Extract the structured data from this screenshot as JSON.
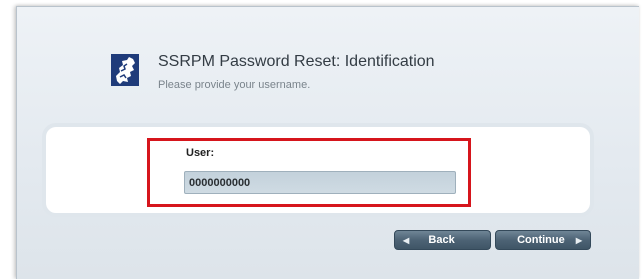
{
  "header": {
    "title": "SSRPM Password Reset: Identification",
    "subtitle": "Please provide your username.",
    "logo_icon": "ssrpm-logo-icon"
  },
  "form": {
    "user_label": "User:",
    "user_value": "0000000000"
  },
  "actions": {
    "back_label": "Back",
    "continue_label": "Continue"
  },
  "colors": {
    "highlight": "#d6151c",
    "button": "#4d6375",
    "logo": "#1f3b7a"
  }
}
